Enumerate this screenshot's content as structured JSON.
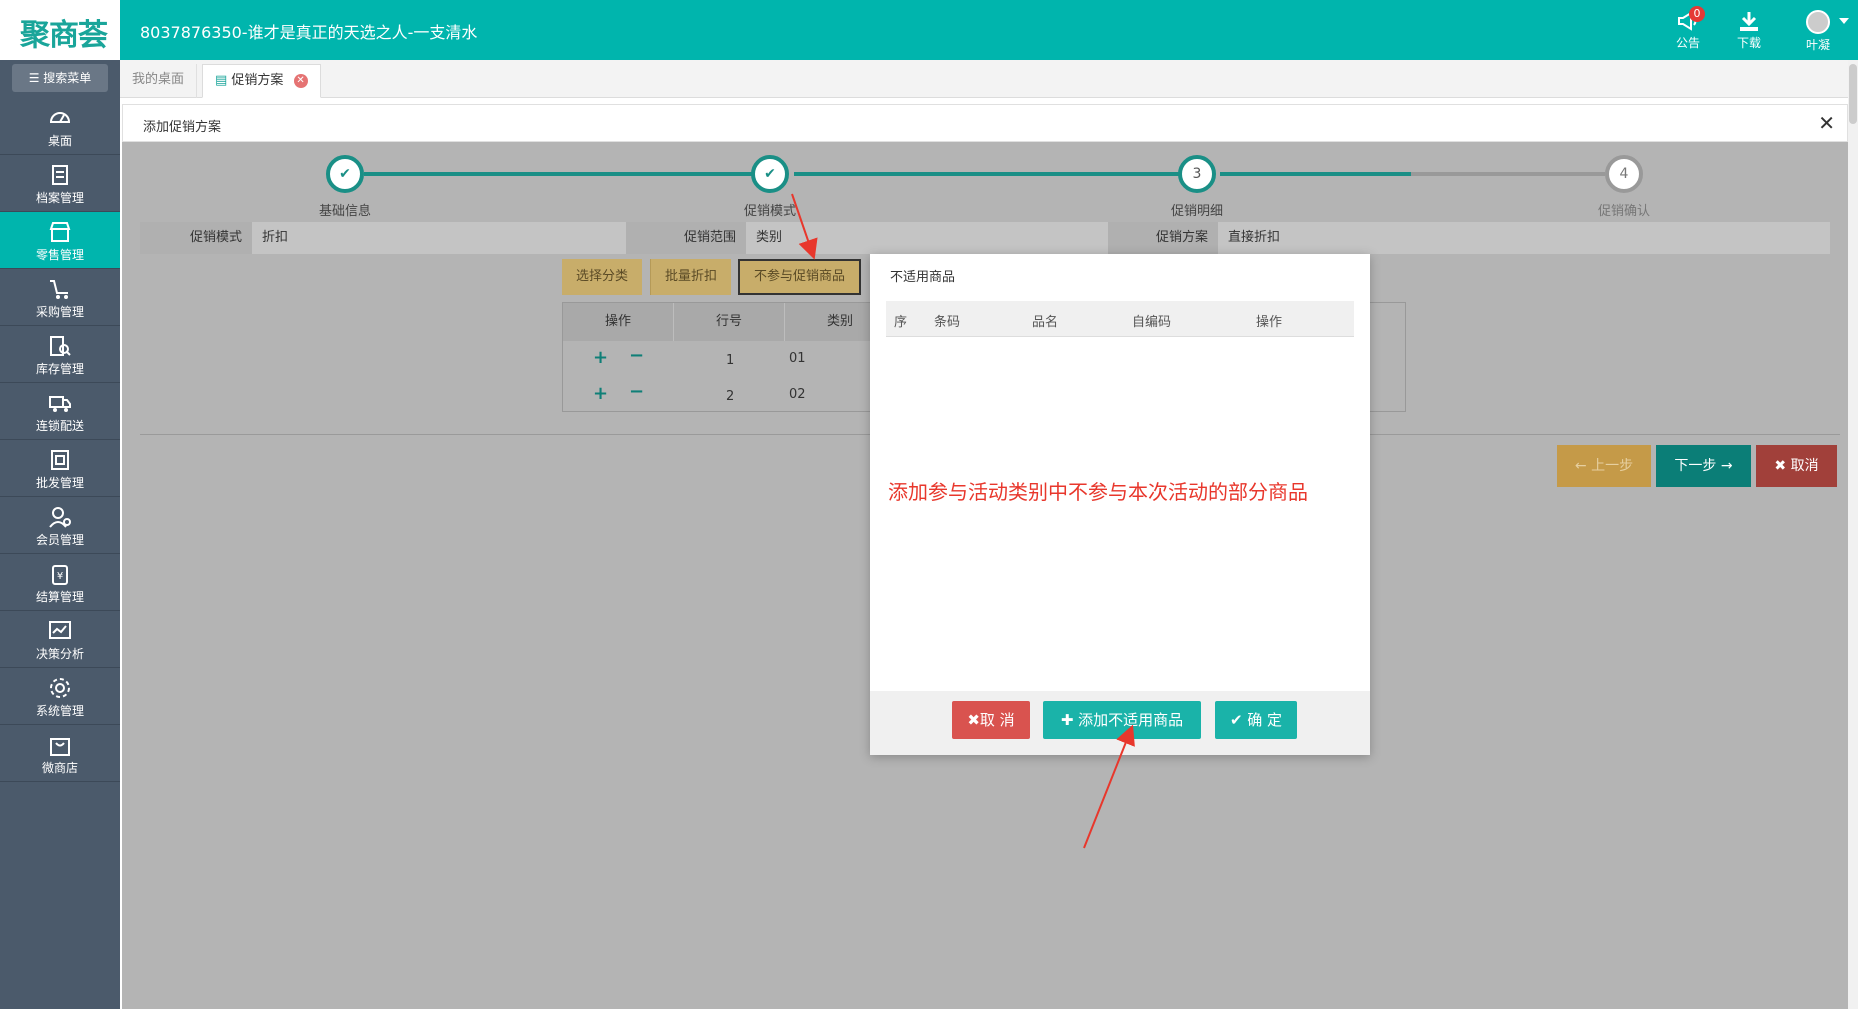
{
  "app": {
    "logo_text": "聚商荟",
    "title": "8037876350-谁才是真正的天选之人-一支清水"
  },
  "topbar": {
    "notice_label": "公告",
    "notice_count": "0",
    "download_label": "下载",
    "user_name": "叶凝"
  },
  "sidebar": {
    "search_label": "搜索菜单",
    "items": [
      {
        "label": "桌面",
        "icon": "dashboard-icon",
        "active": false
      },
      {
        "label": "档案管理",
        "icon": "archive-icon",
        "active": false
      },
      {
        "label": "零售管理",
        "icon": "store-icon",
        "active": true
      },
      {
        "label": "采购管理",
        "icon": "cart-icon",
        "active": false
      },
      {
        "label": "库存管理",
        "icon": "inventory-search-icon",
        "active": false
      },
      {
        "label": "连锁配送",
        "icon": "truck-icon",
        "active": false
      },
      {
        "label": "批发管理",
        "icon": "wholesale-icon",
        "active": false
      },
      {
        "label": "会员管理",
        "icon": "member-icon",
        "active": false
      },
      {
        "label": "结算管理",
        "icon": "settlement-icon",
        "active": false
      },
      {
        "label": "决策分析",
        "icon": "chart-icon",
        "active": false
      },
      {
        "label": "系统管理",
        "icon": "gear-icon",
        "active": false
      },
      {
        "label": "微商店",
        "icon": "shopping-bag-icon",
        "active": false
      }
    ]
  },
  "tabs": {
    "home": "我的桌面",
    "current": "促销方案"
  },
  "page": {
    "header": "添加促销方案",
    "steps": [
      {
        "num": "1",
        "label": "基础信息"
      },
      {
        "num": "2",
        "label": "促销模式"
      },
      {
        "num": "3",
        "label": "促销明细"
      },
      {
        "num": "4",
        "label": "促销确认"
      }
    ],
    "info": {
      "mode_label": "促销模式",
      "mode_value": "折扣",
      "scope_label": "促销范围",
      "scope_value": "类别",
      "plan_label": "促销方案",
      "plan_value": "直接折扣"
    },
    "options": [
      "选择分类",
      "批量折扣",
      "不参与促销商品"
    ],
    "table": {
      "headers": [
        "操作",
        "行号",
        "类别"
      ],
      "rows": [
        {
          "line": "1",
          "category": "01"
        },
        {
          "line": "2",
          "category": "02"
        }
      ]
    },
    "buttons": {
      "prev": "上一步",
      "next": "下一步",
      "cancel": "取消"
    }
  },
  "modal": {
    "title": "不适用商品",
    "headers": [
      "序",
      "条码",
      "品名",
      "自编码",
      "操作"
    ],
    "cancel": "取 消",
    "add": "添加不适用商品",
    "ok": "确 定"
  },
  "annotation": "添加参与活动类别中不参与本次活动的部分商品",
  "colors": {
    "primary": "#00b5ad",
    "sidebar": "#4b5a6b",
    "danger": "#d9534f",
    "annotation": "#e8372c"
  }
}
